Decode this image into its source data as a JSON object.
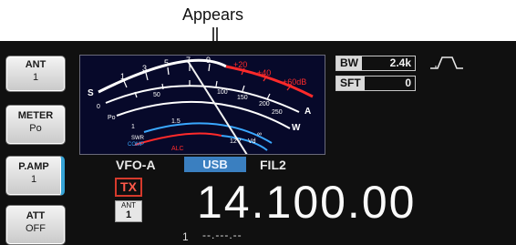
{
  "callout": {
    "text": "Appears"
  },
  "sidebar": {
    "items": [
      {
        "line1": "ANT",
        "line2": "1",
        "active": false
      },
      {
        "line1": "METER",
        "line2": "Po",
        "active": false
      },
      {
        "line1": "P.AMP",
        "line2": "1",
        "active": true
      },
      {
        "line1": "ATT",
        "line2": "OFF",
        "active": false
      }
    ]
  },
  "meter": {
    "scales": {
      "s_label": "S",
      "po_label": "Po",
      "swr_label": "SWR",
      "comp_label": "COMP",
      "alc_label": "ALC",
      "a_label": "A",
      "w_label": "W",
      "vd_label": "Vd",
      "id_label": "Id",
      "s_ticks": [
        "1",
        "3",
        "5",
        "7",
        "9"
      ],
      "plus_ticks": [
        "+20",
        "+40",
        "+60dB"
      ],
      "po_ticks": [
        "0",
        "50",
        "100",
        "150",
        "200",
        "250"
      ],
      "swr_ticks": [
        "1",
        "1.5",
        "2",
        "3",
        "∞"
      ],
      "id_ticks": [
        "0",
        "10",
        "12V",
        "15",
        "20",
        "25"
      ],
      "vd_ticks": [
        "10",
        "15",
        "20"
      ]
    },
    "colors": {
      "bg": "#07092a",
      "white": "#ffffff",
      "red": "#ff2a2a",
      "blue": "#3aa8ff"
    }
  },
  "bw": {
    "label": "BW",
    "value": "2.4k"
  },
  "sft": {
    "label": "SFT",
    "value": "0"
  },
  "vfo": {
    "label": "VFO-A"
  },
  "mode": {
    "label": "USB"
  },
  "filter": {
    "label": "FIL2"
  },
  "tx": {
    "label": "TX"
  },
  "ant_badge": {
    "label": "ANT",
    "value": "1"
  },
  "frequency": {
    "value": "14.100.00"
  },
  "memory": {
    "number": "1",
    "dashes": "--.---.--"
  },
  "icons": {
    "filter_shape": "filter-passband-icon",
    "arrow": "down-arrow-icon"
  }
}
